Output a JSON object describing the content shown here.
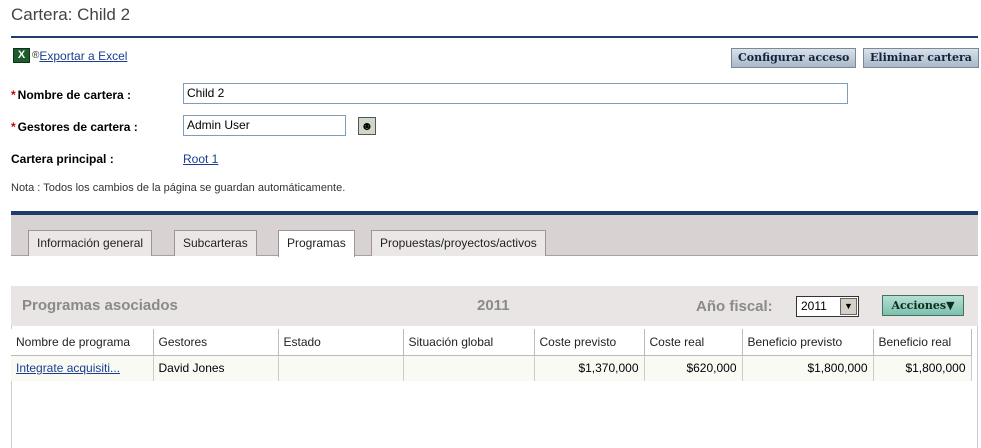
{
  "page": {
    "title": "Cartera: Child 2"
  },
  "excel": {
    "icon": "excel-icon",
    "link_label": "Exportar a Excel",
    "registered_mark": "®"
  },
  "buttons": {
    "configure_access": "Configurar acceso",
    "delete_portfolio": "Eliminar cartera"
  },
  "form": {
    "name_label": "Nombre de cartera :",
    "name_value": "Child 2",
    "managers_label": "Gestores de cartera :",
    "managers_value": "Admin User",
    "parent_label": "Cartera principal :",
    "parent_value": "Root 1",
    "required_mark": "*"
  },
  "note": "Nota : Todos los cambios de la página se guardan automáticamente.",
  "tabs": [
    {
      "label": "Información general"
    },
    {
      "label": "Subcarteras"
    },
    {
      "label": "Programas"
    },
    {
      "label": "Propuestas/proyectos/activos"
    }
  ],
  "programs": {
    "section_title": "Programas asociados",
    "year": "2011",
    "fiscal_year_label": "Año fiscal:",
    "fiscal_year_value": "2011",
    "actions_label": "Acciones▼",
    "columns": [
      "Nombre de programa",
      "Gestores",
      "Estado",
      "Situación global",
      "Coste previsto",
      "Coste real",
      "Beneficio previsto",
      "Beneficio real"
    ],
    "rows": [
      {
        "name": "Integrate acquisiti...",
        "managers": "David Jones",
        "status": "",
        "overall": "",
        "planned_cost": "$1,370,000",
        "actual_cost": "$620,000",
        "planned_benefit": "$1,800,000",
        "actual_benefit": "$1,800,000"
      }
    ]
  },
  "colors": {
    "rule": "#1f3c6e",
    "link": "#1a3e91",
    "required": "#cc0000"
  }
}
